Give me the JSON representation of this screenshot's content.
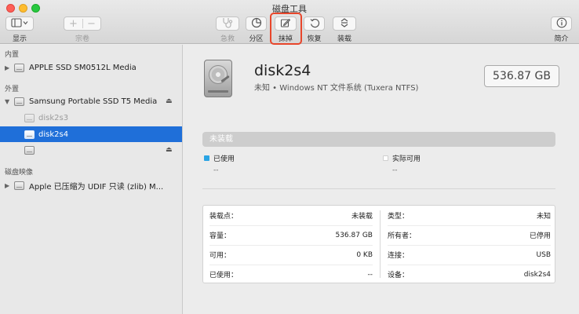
{
  "window": {
    "title": "磁盘工具"
  },
  "toolbar": {
    "display_label": "显示",
    "volume_label": "宗卷",
    "volume_add": "+",
    "volume_remove": "−",
    "firstaid_label": "急救",
    "partition_label": "分区",
    "erase_label": "抹掉",
    "restore_label": "恢复",
    "mount_label": "装载",
    "info_label": "简介"
  },
  "sidebar": {
    "internal_header": "内置",
    "external_header": "外置",
    "images_header": "磁盘映像",
    "items": [
      {
        "label": "APPLE SSD SM0512L Media"
      },
      {
        "label": "Samsung Portable SSD T5 Media"
      },
      {
        "label": "disk2s3"
      },
      {
        "label": "disk2s4"
      },
      {
        "label": ""
      },
      {
        "label": "Apple 已压缩为 UDIF 只读 (zlib) M..."
      }
    ]
  },
  "volume": {
    "name": "disk2s4",
    "subtitle": "未知 • Windows NT 文件系统 (Tuxera NTFS)",
    "size": "536.87 GB"
  },
  "usage": {
    "bar_label": "未装载",
    "used_label": "已使用",
    "used_value": "--",
    "free_label": "实际可用",
    "free_value": "--",
    "used_color": "#2aa4e4",
    "free_color": "#ffffff"
  },
  "info": {
    "left": [
      {
        "key": "装载点：",
        "value": "未装载"
      },
      {
        "key": "容量：",
        "value": "536.87 GB"
      },
      {
        "key": "可用：",
        "value": "0 KB"
      },
      {
        "key": "已使用：",
        "value": "--"
      }
    ],
    "right": [
      {
        "key": "类型：",
        "value": "未知"
      },
      {
        "key": "所有者：",
        "value": "已停用"
      },
      {
        "key": "连接：",
        "value": "USB"
      },
      {
        "key": "设备：",
        "value": "disk2s4"
      }
    ]
  },
  "colors": {
    "selection": "#1f6fd9",
    "highlight_border": "#e8462b"
  }
}
